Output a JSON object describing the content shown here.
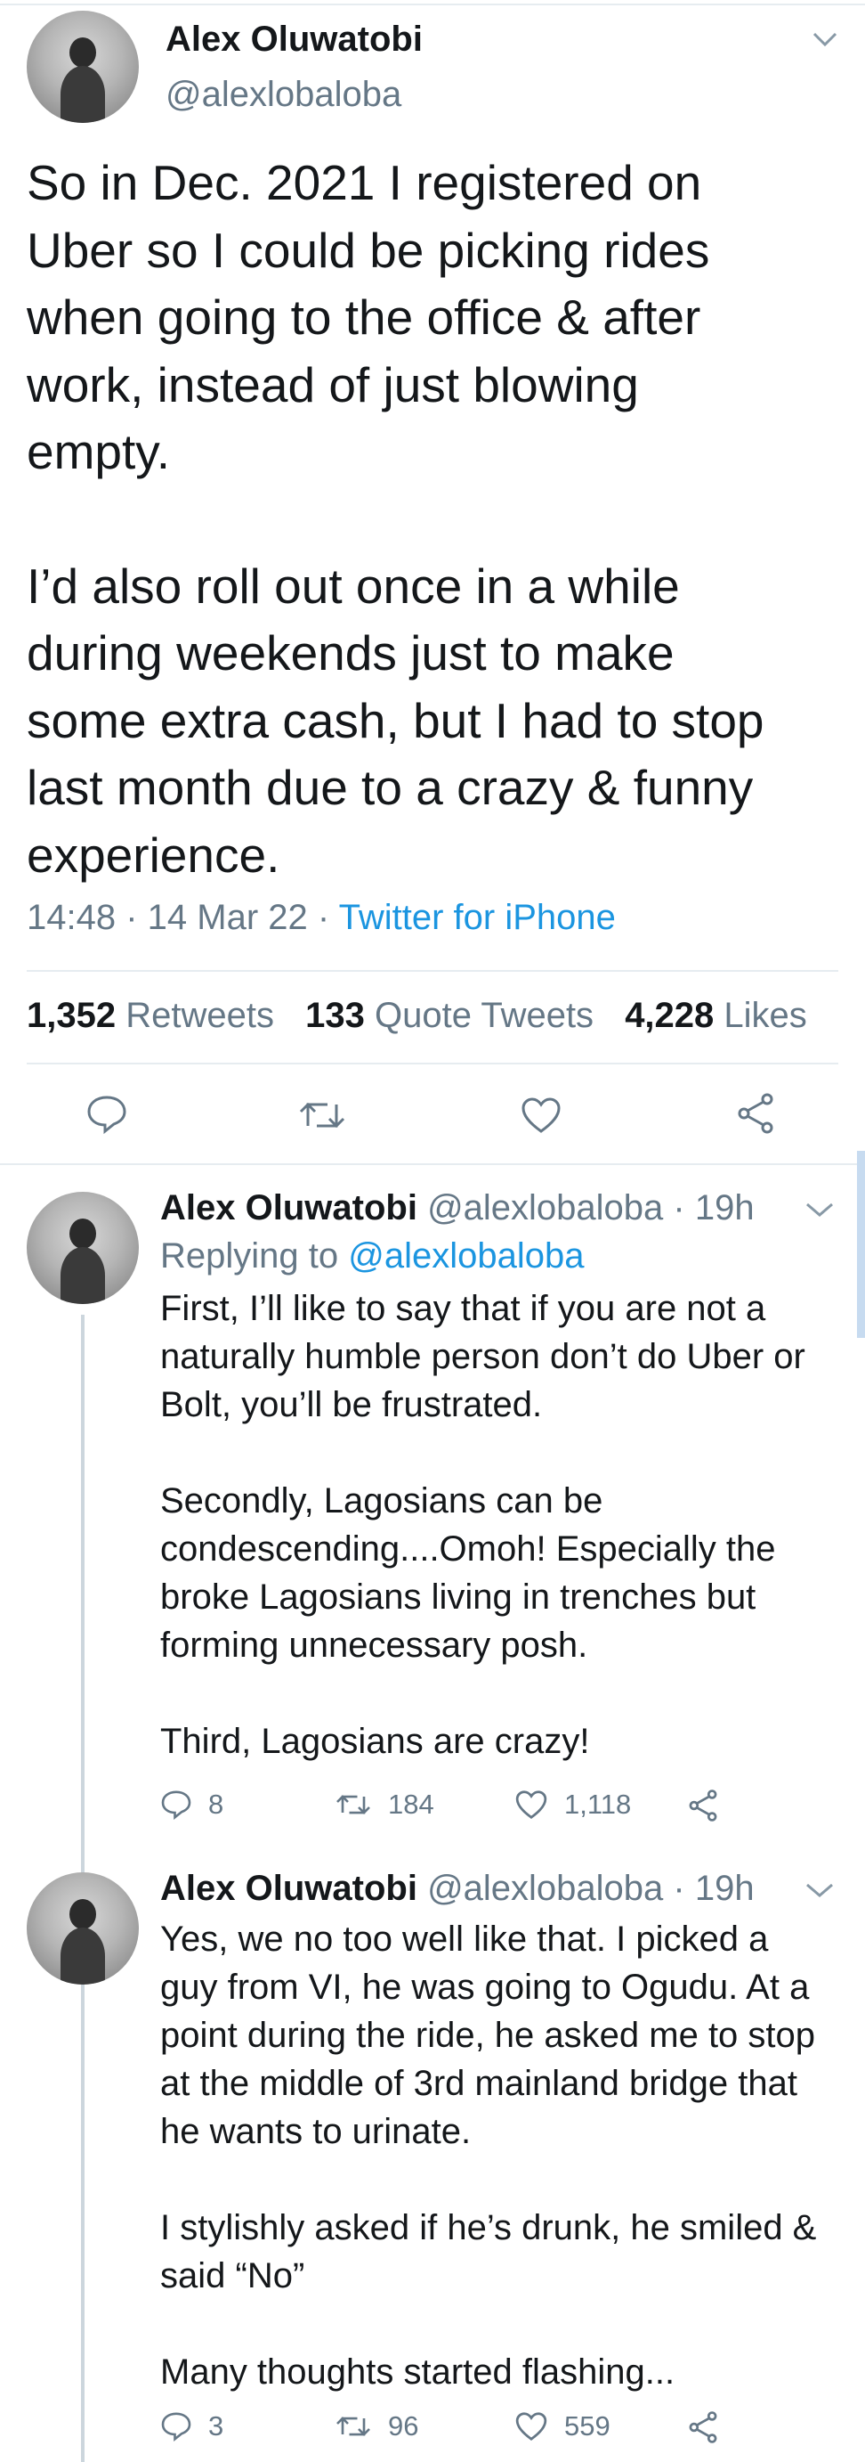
{
  "main_tweet": {
    "name": "Alex Oluwatobi",
    "handle": "@alexlobaloba",
    "text_p1": "So in Dec. 2021 I registered on\nUber so I could be picking rides\nwhen going to the office & after\nwork, instead of just blowing\nempty.",
    "text_p2": "I’d also roll out once in a while\nduring weekends just to make\nsome extra cash, but I had to stop\nlast month due to a crazy & funny\nexperience.",
    "time": "14:48",
    "date": "14 Mar 22",
    "source": "Twitter for iPhone",
    "retweets_count": "1,352",
    "retweets_label": "Retweets",
    "quotes_count": "133",
    "quotes_label": "Quote Tweets",
    "likes_count": "4,228",
    "likes_label": "Likes"
  },
  "replies": [
    {
      "name": "Alex Oluwatobi",
      "handle": "@alexlobaloba",
      "age": "· 19h",
      "replying_label": "Replying to",
      "replying_to": "@alexlobaloba",
      "text": "First, I’ll like to say that if you are not a\nnaturally humble person don’t do Uber or\nBolt, you’ll be frustrated.\n\nSecondly, Lagosians can be\ncondescending....Omoh! Especially the\nbroke Lagosians living in trenches but\nforming unnecessary posh.\n\nThird, Lagosians are crazy!",
      "reply_count": "8",
      "retweet_count": "184",
      "like_count": "1,118"
    },
    {
      "name": "Alex Oluwatobi",
      "handle": "@alexlobaloba",
      "age": "· 19h",
      "text": "Yes, we no too well like that. I picked a\nguy from VI, he was going to Ogudu. At a\npoint during the ride, he asked me to stop\nat the middle of 3rd mainland bridge that\nhe wants to urinate.\n\nI stylishly asked if he’s drunk, he smiled &\nsaid “No”\n\nMany thoughts started flashing...",
      "reply_count": "3",
      "retweet_count": "96",
      "like_count": "559"
    }
  ],
  "colors": {
    "link": "#1b95e0",
    "secondary": "#657786",
    "divider": "#e6ecf0",
    "thread_line": "#ccd6dd"
  },
  "icons": [
    "chevron-down-icon",
    "reply-icon",
    "retweet-icon",
    "like-icon",
    "share-icon"
  ]
}
